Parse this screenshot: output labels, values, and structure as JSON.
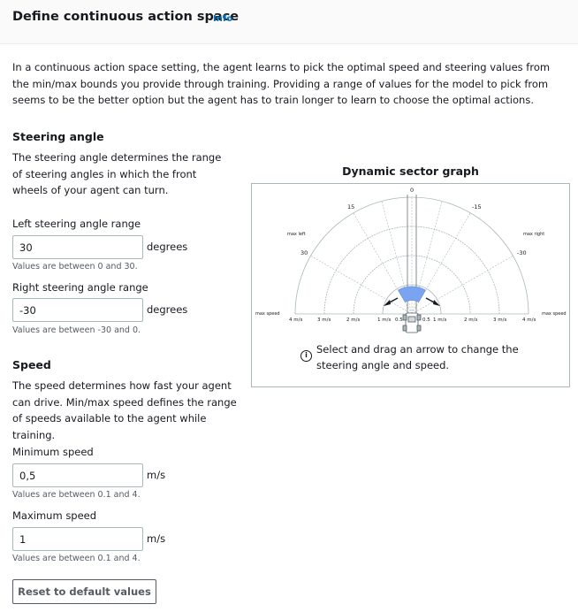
{
  "header": {
    "title": "Define continuous action space",
    "info_link": "Info"
  },
  "intro": "In a continuous action space setting, the agent learns to pick the optimal speed and steering values from the min/max bounds you provide through training. Providing a range of values for the model to pick from seems to be the better option but the agent has to train longer to learn to choose the optimal actions.",
  "steering": {
    "title": "Steering angle",
    "description": "The steering angle determines the range of steering angles in which the front wheels of your agent can turn.",
    "left": {
      "label": "Left steering angle range",
      "value": "30",
      "unit": "degrees",
      "hint": "Values are between 0 and 30."
    },
    "right": {
      "label": "Right steering angle range",
      "value": "-30",
      "unit": "degrees",
      "hint": "Values are between -30 and 0."
    }
  },
  "speed": {
    "title": "Speed",
    "description": "The speed determines how fast your agent can drive. Min/max speed defines the range of speeds available to the agent while training.",
    "min": {
      "label": "Minimum speed",
      "value": "0,5",
      "unit": "m/s",
      "hint": "Values are between 0.1 and 4."
    },
    "max": {
      "label": "Maximum speed",
      "value": "1",
      "unit": "m/s",
      "hint": "Values are between 0.1 and 4."
    }
  },
  "reset_button": "Reset to default values",
  "graph": {
    "title": "Dynamic sector graph",
    "labels": {
      "max_left": "max left",
      "max_right": "max right",
      "max_speed_left": "max speed",
      "max_speed_right": "max speed",
      "angle_top_left": "15",
      "angle_top_center": "0",
      "angle_top_right": "-15",
      "left_value": "30",
      "right_value": "-30"
    },
    "speed_ticks_left": [
      "4 m/s",
      "3 m/s",
      "2 m/s",
      "1 m/s",
      "0.5"
    ],
    "speed_ticks_right": [
      "0.5",
      "1 m/s",
      "2 m/s",
      "3 m/s",
      "4 m/s"
    ],
    "sector_color": "#7aa4f0",
    "instruction": "Select and drag an arrow to change the steering angle and speed.",
    "info_icon_glyph": "i"
  }
}
